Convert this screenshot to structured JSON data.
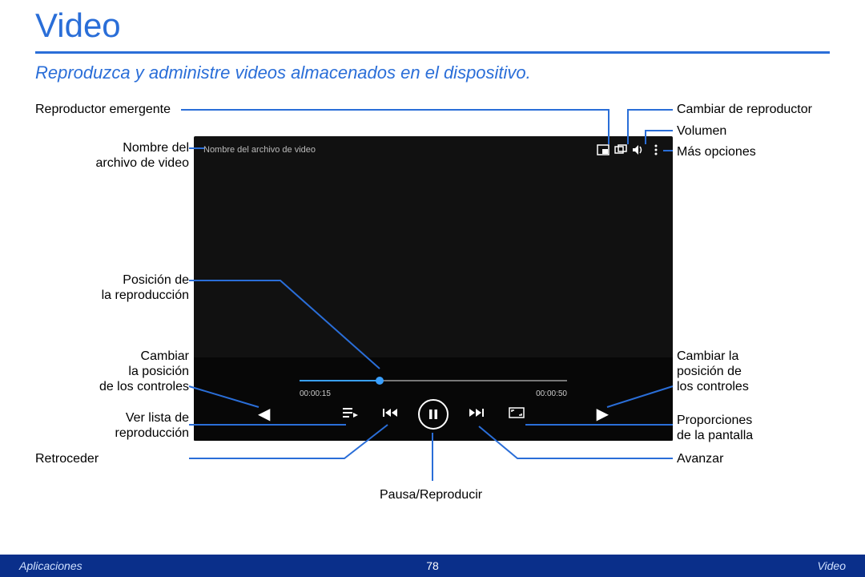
{
  "header": {
    "title": "Video",
    "subtitle": "Reproduzca y administre videos almacenados en el dispositivo."
  },
  "player": {
    "filename_placeholder": "Nombre del archivo de video",
    "time_elapsed": "00:00:15",
    "time_total": "00:00:50"
  },
  "callouts": {
    "popup_player": "Reproductor emergente",
    "change_player": "Cambiar de reproductor",
    "volume": "Volumen",
    "more_options": "Más opciones",
    "filename": "Nombre del\narchivo de video",
    "playback_position": "Posición de\nla reproducción",
    "move_controls_left": "Cambiar\nla posición\nde los controles",
    "move_controls_right": "Cambiar la\nposición de\nlos controles",
    "playlist": "Ver lista de\nreproducción",
    "rewind": "Retroceder",
    "play_pause": "Pausa/Reproducir",
    "forward": "Avanzar",
    "aspect_ratio": "Proporciones\nde la pantalla"
  },
  "footer": {
    "left": "Aplicaciones",
    "page": "78",
    "right": "Video"
  }
}
